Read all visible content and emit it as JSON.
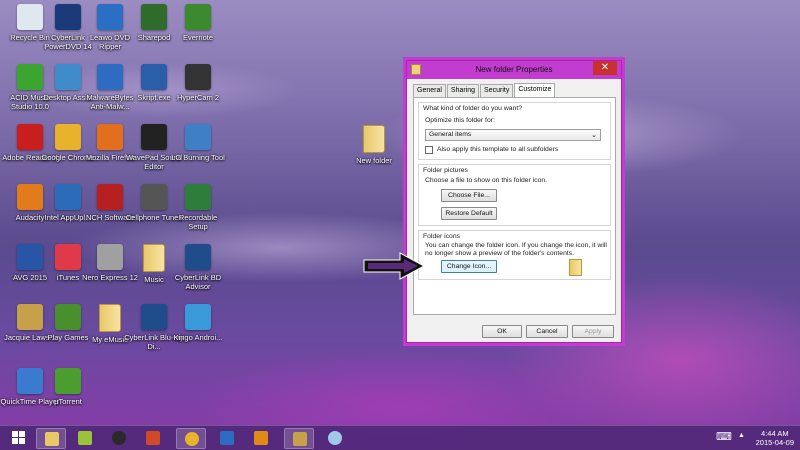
{
  "desktop": {
    "icons": [
      {
        "label": "Recycle Bin",
        "icon": "recycle-bin-icon",
        "color": "#dfe8ef"
      },
      {
        "label": "CyberLink PowerDVD 14",
        "icon": "powerdvd-icon",
        "color": "#1a3a7a"
      },
      {
        "label": "Leawo DVD Ripper",
        "icon": "leawo-icon",
        "color": "#2b6fc4"
      },
      {
        "label": "Sharepod",
        "icon": "sharepod-icon",
        "color": "#2f6b2a"
      },
      {
        "label": "Evernote",
        "icon": "evernote-icon",
        "color": "#3c8a2e"
      },
      {
        "label": "ACID Music Studio 10.0",
        "icon": "acid-icon",
        "color": "#3aa62f"
      },
      {
        "label": "Desktop Assist",
        "icon": "desktop-assist-icon",
        "color": "#3f8bc9"
      },
      {
        "label": "MalwareBytes Anti-Malw...",
        "icon": "malwarebytes-icon",
        "color": "#2d6cc0"
      },
      {
        "label": "Skript.exe",
        "icon": "skript-icon",
        "color": "#2a5ea8"
      },
      {
        "label": "HyperCam 2",
        "icon": "hypercam-icon",
        "color": "#333333"
      },
      {
        "label": "Adobe Reader X",
        "icon": "adobe-reader-icon",
        "color": "#c81e1e"
      },
      {
        "label": "Google Chrome",
        "icon": "chrome-icon",
        "color": "#e8b32a"
      },
      {
        "label": "Mozilla Firefox",
        "icon": "firefox-icon",
        "color": "#e0701d"
      },
      {
        "label": "WavePad Sound Editor",
        "icon": "wavepad-icon",
        "color": "#222222"
      },
      {
        "label": "LG Burning Tool",
        "icon": "lg-burning-icon",
        "color": "#3f7fc5"
      },
      {
        "label": "Audacity",
        "icon": "audacity-icon",
        "color": "#e27b1a"
      },
      {
        "label": "Intel AppUpl...",
        "icon": "intel-icon",
        "color": "#2a6cb8"
      },
      {
        "label": "NCH Software",
        "icon": "nch-icon",
        "color": "#b72020"
      },
      {
        "label": "Cellphone Tunes",
        "icon": "cellphone-tunes-icon",
        "color": "#555555"
      },
      {
        "label": "Recordable Setup",
        "icon": "recordable-icon",
        "color": "#2f7d3a"
      },
      {
        "label": "AVG 2015",
        "icon": "avg-icon",
        "color": "#2855a5"
      },
      {
        "label": "iTunes",
        "icon": "itunes-icon",
        "color": "#e03a4a"
      },
      {
        "label": "Nero Express 12",
        "icon": "nero-icon",
        "color": "#a0a0a0"
      },
      {
        "label": "Music",
        "icon": "folder-icon",
        "color": "#e9c86a"
      },
      {
        "label": "CyberLink BD Advisor",
        "icon": "bd-advisor-icon",
        "color": "#1f4c8a"
      },
      {
        "label": "Jacquie Laws...",
        "icon": "jacquie-icon",
        "color": "#c7a14a"
      },
      {
        "label": "Play Games",
        "icon": "play-games-icon",
        "color": "#4a8f2d"
      },
      {
        "label": "My eMusic",
        "icon": "folder-icon",
        "color": "#e9c86a"
      },
      {
        "label": "CyberLink Blu-ray Di...",
        "icon": "bluray-icon",
        "color": "#1f4c8a"
      },
      {
        "label": "Kingo Androi...",
        "icon": "kingo-icon",
        "color": "#3a9ad9"
      },
      {
        "label": "QuickTime Player",
        "icon": "quicktime-icon",
        "color": "#3a7bd0"
      },
      {
        "label": "µTorrent",
        "icon": "utorrent-icon",
        "color": "#4a9d2e"
      }
    ],
    "new_folder_label": "New folder"
  },
  "dialog": {
    "title": "New folder Properties",
    "close": "✕",
    "tabs": [
      "General",
      "Sharing",
      "Security",
      "Customize"
    ],
    "optimize_heading": "What kind of folder do you want?",
    "optimize_label": "Optimize this folder for:",
    "optimize_value": "General items",
    "apply_subfolders": "Also apply this template to all subfolders",
    "pictures_heading": "Folder pictures",
    "pictures_desc": "Choose a file to show on this folder icon.",
    "choose_file": "Choose File...",
    "restore_default": "Restore Default",
    "icons_heading": "Folder icons",
    "icons_desc_1": "You can change the folder icon. If you change the icon, it will",
    "icons_desc_2": "no longer show a preview of the folder's contents.",
    "change_icon": "Change Icon...",
    "ok": "OK",
    "cancel": "Cancel",
    "apply": "Apply"
  },
  "taskbar": {
    "time": "4:44 AM",
    "date": "2015-04-09",
    "keyboard": "⌨",
    "chevron": "▲"
  }
}
